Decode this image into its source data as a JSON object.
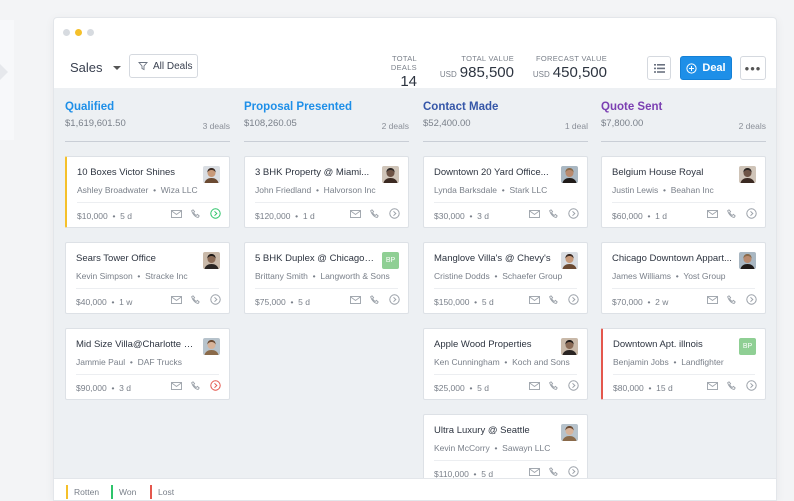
{
  "window": {
    "dot_colors": [
      "#d7dbe0",
      "#f5c02a",
      "#d7dbe0"
    ]
  },
  "toolbar": {
    "pipeline": "Sales",
    "filter_label": "All Deals",
    "stats": {
      "total_deals_label": "TOTAL DEALS",
      "total_deals": "14",
      "total_value_label": "TOTAL VALUE",
      "total_value_currency": "USD",
      "total_value": "985,500",
      "forecast_label": "FORECAST VALUE",
      "forecast_currency": "USD",
      "forecast_value": "450,500"
    },
    "deal_label": "Deal"
  },
  "colors": {
    "qualified": "#1e8fe8",
    "proposal": "#1e8fe8",
    "contact": "#3556a8",
    "quote": "#7b3fb2",
    "rotten": "#f5c02a",
    "won": "#2ec46b",
    "lost": "#e4574d"
  },
  "columns": [
    {
      "title": "Qualified",
      "amount": "$1,619,601.50",
      "count": "3 deals",
      "cards": [
        {
          "title": "10 Boxes Victor Shines",
          "person": "Ashley Broadwater",
          "org": "Wiza LLC",
          "value": "$10,000",
          "age": "5 d",
          "status_icon": "arrow-circle-green-icon"
        },
        {
          "title": "Sears Tower Office",
          "person": "Kevin Simpson",
          "org": "Stracke Inc",
          "value": "$40,000",
          "age": "1 w"
        },
        {
          "title": "Mid Size Villa@Charlotte NC",
          "person": "Jammie Paul",
          "org": "DAF Trucks",
          "value": "$90,000",
          "age": "3 d",
          "status_icon": "arrow-circle-red-icon"
        }
      ]
    },
    {
      "title": "Proposal Presented",
      "amount": "$108,260.05",
      "count": "2 deals",
      "cards": [
        {
          "title": "3 BHK Property @ Miami...",
          "person": "John Friedland",
          "org": "Halvorson Inc",
          "value": "$120,000",
          "age": "1 d"
        },
        {
          "title": "5 BHK Duplex @ Chicago H...",
          "person": "Brittany Smith",
          "org": "Langworth & Sons",
          "value": "$75,000",
          "age": "5 d",
          "initials": "BP"
        }
      ]
    },
    {
      "title": "Contact Made",
      "amount": "$52,400.00",
      "count": "1 deal",
      "cards": [
        {
          "title": "Downtown 20 Yard Office...",
          "person": "Lynda Barksdale",
          "org": "Stark LLC",
          "value": "$30,000",
          "age": "3 d"
        },
        {
          "title": "Manglove Villa's @ Chevy's",
          "person": "Cristine Dodds",
          "org": "Schaefer Group",
          "value": "$150,000",
          "age": "5 d"
        },
        {
          "title": "Apple Wood Properties",
          "person": "Ken Cunningham",
          "org": "Koch and Sons",
          "value": "$25,000",
          "age": "5 d"
        },
        {
          "title": "Ultra Luxury @ Seattle",
          "person": "Kevin McCorry",
          "org": "Sawayn LLC",
          "value": "$110,000",
          "age": "5 d"
        }
      ]
    },
    {
      "title": "Quote Sent",
      "amount": "$7,800.00",
      "count": "2 deals",
      "cards": [
        {
          "title": "Belgium House Royal",
          "person": "Justin Lewis",
          "org": "Beahan Inc",
          "value": "$60,000",
          "age": "1 d"
        },
        {
          "title": "Chicago Downtown Appart...",
          "person": "James Williams",
          "org": "Yost Group",
          "value": "$70,000",
          "age": "2 w"
        },
        {
          "title": "Downtown Apt. illnois",
          "person": "Benjamin Jobs",
          "org": "Landfighter",
          "value": "$80,000",
          "age": "15 d",
          "initials": "BP"
        }
      ]
    }
  ],
  "legend": {
    "rotten": "Rotten",
    "won": "Won",
    "lost": "Lost"
  }
}
